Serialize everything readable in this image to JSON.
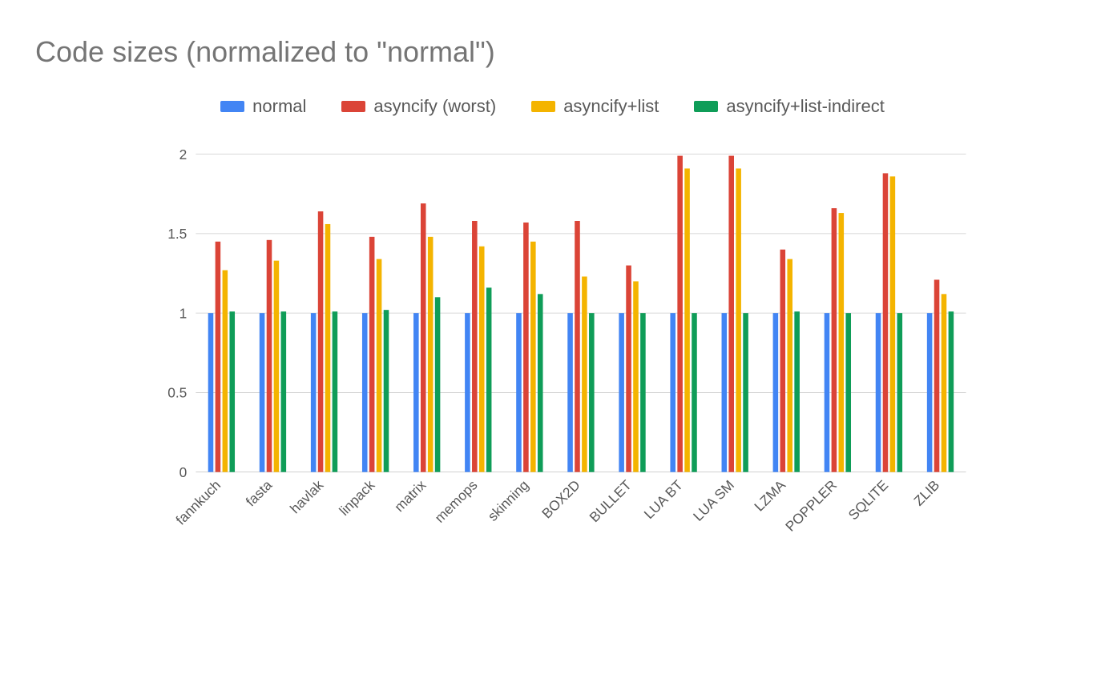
{
  "title": "Code sizes (normalized to \"normal\")",
  "legend": [
    {
      "key": "normal",
      "label": "normal",
      "color": "#4285f4"
    },
    {
      "key": "asyncify_worst",
      "label": "asyncify (worst)",
      "color": "#db4437"
    },
    {
      "key": "asyncify_list",
      "label": "asyncify+list",
      "color": "#f4b400"
    },
    {
      "key": "asyncify_list_indirect",
      "label": "asyncify+list-indirect",
      "color": "#0f9d58"
    }
  ],
  "chart_data": {
    "type": "bar",
    "title": "Code sizes (normalized to \"normal\")",
    "xlabel": "",
    "ylabel": "",
    "ylim": [
      0,
      2
    ],
    "yticks": [
      0,
      0.5,
      1,
      1.5,
      2
    ],
    "categories": [
      "fannkuch",
      "fasta",
      "havlak",
      "linpack",
      "matrix",
      "memops",
      "skinning",
      "BOX2D",
      "BULLET",
      "LUA BT",
      "LUA SM",
      "LZMA",
      "POPPLER",
      "SQLITE",
      "ZLIB"
    ],
    "series": [
      {
        "name": "normal",
        "color": "#4285f4",
        "values": [
          1.0,
          1.0,
          1.0,
          1.0,
          1.0,
          1.0,
          1.0,
          1.0,
          1.0,
          1.0,
          1.0,
          1.0,
          1.0,
          1.0,
          1.0
        ]
      },
      {
        "name": "asyncify (worst)",
        "color": "#db4437",
        "values": [
          1.45,
          1.46,
          1.64,
          1.48,
          1.69,
          1.58,
          1.57,
          1.58,
          1.3,
          1.99,
          1.99,
          1.4,
          1.66,
          1.88,
          1.21
        ]
      },
      {
        "name": "asyncify+list",
        "color": "#f4b400",
        "values": [
          1.27,
          1.33,
          1.56,
          1.34,
          1.48,
          1.42,
          1.45,
          1.23,
          1.2,
          1.91,
          1.91,
          1.34,
          1.63,
          1.86,
          1.12
        ]
      },
      {
        "name": "asyncify+list-indirect",
        "color": "#0f9d58",
        "values": [
          1.01,
          1.01,
          1.01,
          1.02,
          1.1,
          1.16,
          1.12,
          1.0,
          1.0,
          1.0,
          1.0,
          1.01,
          1.0,
          1.0,
          1.01
        ]
      }
    ]
  }
}
